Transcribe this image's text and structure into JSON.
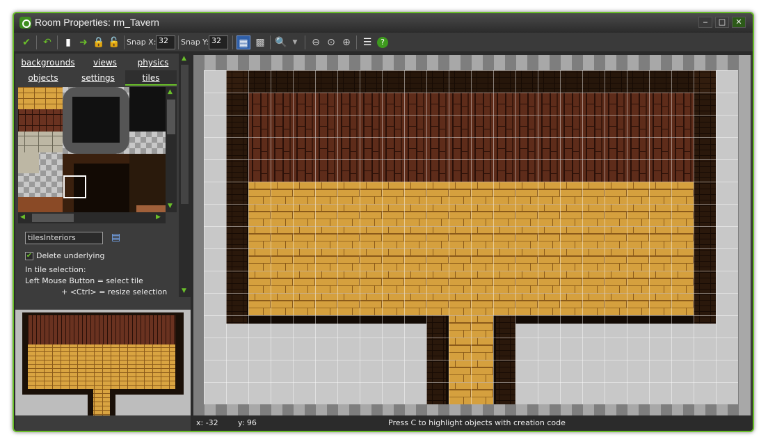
{
  "window": {
    "title": "Room Properties: rm_Tavern"
  },
  "window_buttons": {
    "minimize": "‒",
    "maximize": "□",
    "close": "✕"
  },
  "toolbar": {
    "snap_x_label": "Snap X:",
    "snap_x_value": "32",
    "snap_y_label": "Snap Y:",
    "snap_y_value": "32"
  },
  "tabs": {
    "row1": [
      "backgrounds",
      "views",
      "physics"
    ],
    "row2": [
      "objects",
      "settings",
      "tiles"
    ],
    "active": "tiles"
  },
  "tiles_panel": {
    "tileset_name": "tilesInteriors",
    "delete_underlying_label": "Delete underlying",
    "delete_underlying_checked": true,
    "info_lines": [
      "In tile selection:",
      "Left Mouse Button  = select tile",
      "+ <Ctrl> = resize selection"
    ]
  },
  "status": {
    "x": "x: -32",
    "y": "y: 96",
    "message": "Press C to highlight objects with creation code"
  },
  "colors": {
    "accent": "#6abf2a",
    "dark_wood": "#5a2a18",
    "light_wood": "#d9a441",
    "wall_shadow": "#1a1008"
  }
}
